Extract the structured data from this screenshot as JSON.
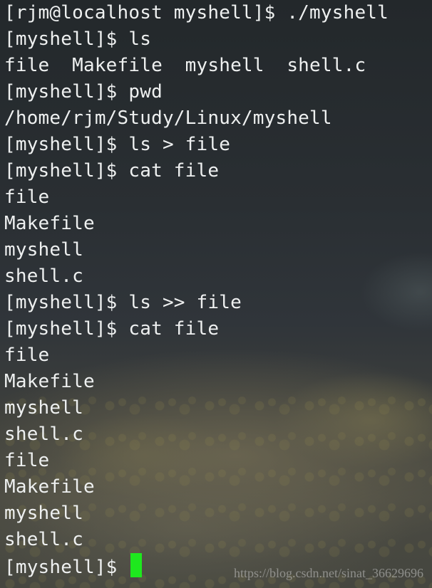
{
  "terminal": {
    "lines": [
      "[rjm@localhost myshell]$ ./myshell",
      "[myshell]$ ls",
      "file  Makefile  myshell  shell.c",
      "[myshell]$ pwd",
      "/home/rjm/Study/Linux/myshell",
      "[myshell]$ ls > file",
      "[myshell]$ cat file",
      "file",
      "Makefile",
      "myshell",
      "shell.c",
      "[myshell]$ ls >> file",
      "[myshell]$ cat file",
      "file",
      "Makefile",
      "myshell",
      "shell.c",
      "file",
      "Makefile",
      "myshell",
      "shell.c"
    ],
    "prompt": "[myshell]$ ",
    "cursor_color": "#1ee81e",
    "text_color": "#eef0f0"
  },
  "watermark": {
    "text": "https://blog.csdn.net/sinat_36629696"
  }
}
